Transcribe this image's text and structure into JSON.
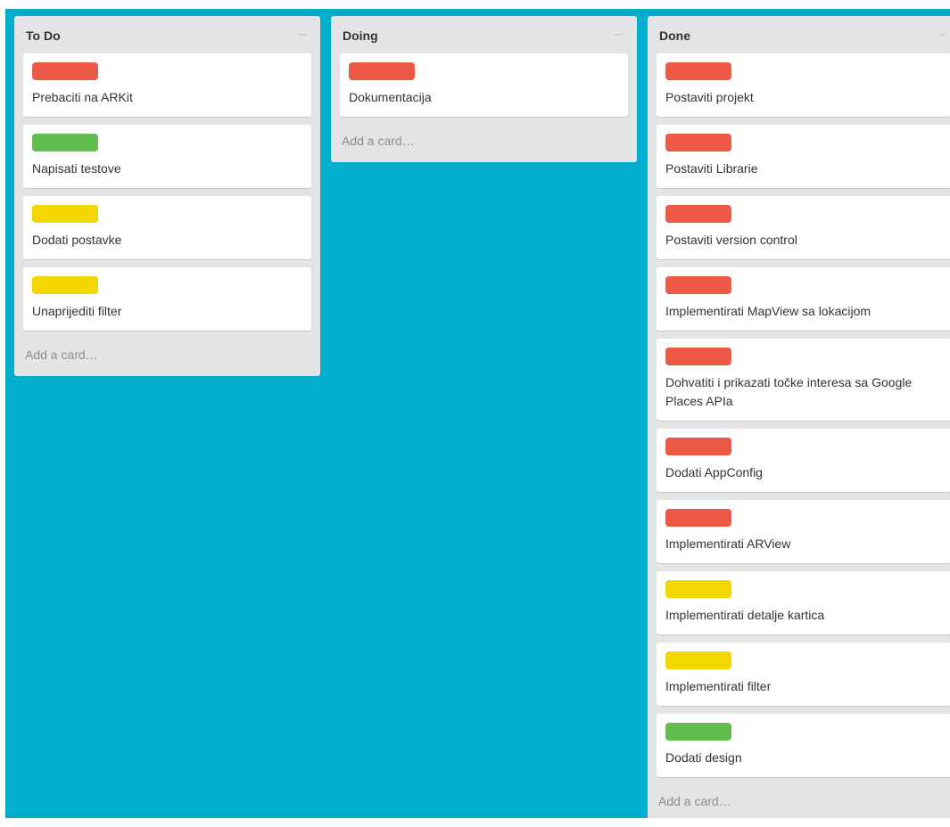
{
  "colors": {
    "board_bg": "#00aecc",
    "red": "#eb5a46",
    "green": "#61bd4f",
    "yellow": "#f2d600"
  },
  "lists": [
    {
      "title": "To Do",
      "menu_label": "···",
      "add_card": "Add a card…",
      "cards": [
        {
          "label": "red",
          "title": "Prebaciti na ARKit"
        },
        {
          "label": "green",
          "title": "Napisati testove"
        },
        {
          "label": "yellow",
          "title": "Dodati postavke"
        },
        {
          "label": "yellow",
          "title": "Unaprijediti filter"
        }
      ]
    },
    {
      "title": "Doing",
      "menu_label": "···",
      "add_card": "Add a card…",
      "cards": [
        {
          "label": "red",
          "title": "Dokumentacija"
        }
      ]
    },
    {
      "title": "Done",
      "menu_label": "···",
      "add_card": "Add a card…",
      "cards": [
        {
          "label": "red",
          "title": "Postaviti projekt"
        },
        {
          "label": "red",
          "title": "Postaviti Librarie"
        },
        {
          "label": "red",
          "title": "Postaviti version control"
        },
        {
          "label": "red",
          "title": "Implementirati MapView sa lokacijom"
        },
        {
          "label": "red",
          "title": "Dohvatiti i prikazati točke interesa sa Google Places APIa"
        },
        {
          "label": "red",
          "title": "Dodati AppConfig"
        },
        {
          "label": "red",
          "title": "Implementirati ARView"
        },
        {
          "label": "yellow",
          "title": "Implementirati detalje kartica"
        },
        {
          "label": "yellow",
          "title": "Implementirati filter"
        },
        {
          "label": "green",
          "title": "Dodati design"
        }
      ]
    }
  ]
}
